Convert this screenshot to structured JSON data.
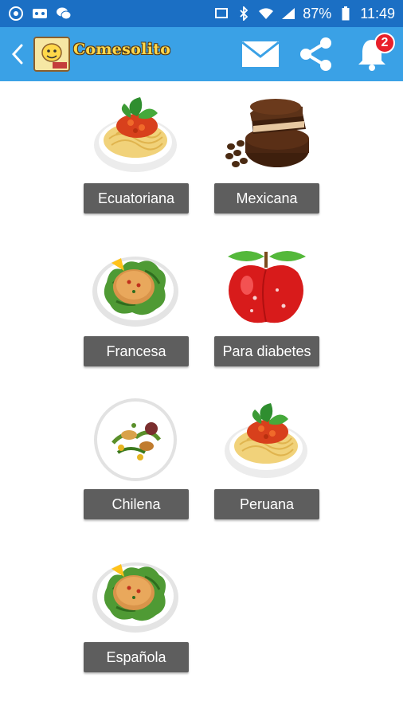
{
  "status_bar": {
    "battery": "87%",
    "time": "11:49",
    "icons": [
      "aperture-icon",
      "voicemail-icon",
      "wechat-icon",
      "cast-icon",
      "bluetooth-icon",
      "wifi-icon",
      "signal-icon",
      "battery-icon"
    ]
  },
  "app_bar": {
    "title": "Comesolito",
    "notification_count": "2",
    "colors": {
      "status": "#1b6fc4",
      "bar": "#3aa1e6",
      "badge": "#e8202a"
    }
  },
  "categories": [
    {
      "label": "Ecuatoriana",
      "image": "spaghetti"
    },
    {
      "label": "Mexicana",
      "image": "chocolate-cake"
    },
    {
      "label": "Francesa",
      "image": "chicken-salad"
    },
    {
      "label": "Para diabetes",
      "image": "red-apple"
    },
    {
      "label": "Chilena",
      "image": "plated-dish"
    },
    {
      "label": "Peruana",
      "image": "spaghetti"
    },
    {
      "label": "Española",
      "image": "chicken-salad"
    }
  ]
}
